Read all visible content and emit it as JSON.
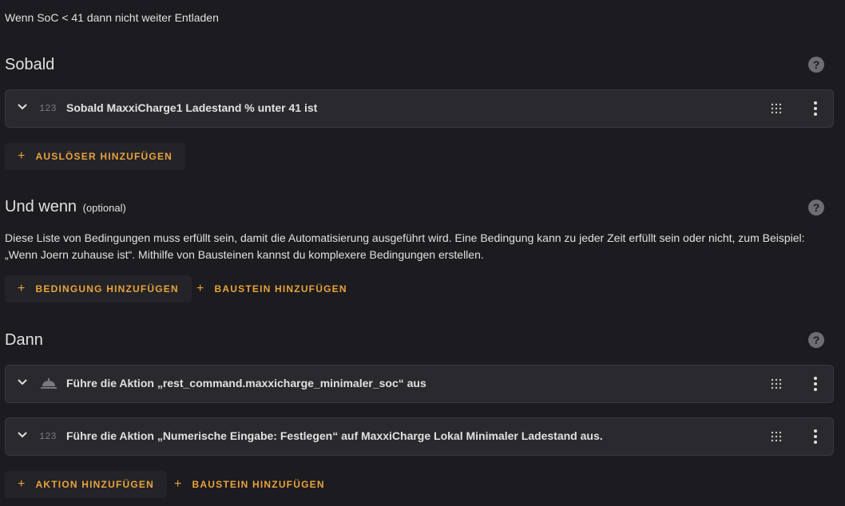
{
  "automation": {
    "description": "Wenn SoC < 41 dann nicht weiter Entladen"
  },
  "triggers": {
    "title": "Sobald",
    "help_icon": "help-circle-icon",
    "items": [
      {
        "label": "Sobald MaxxiCharge1 Ladestand % unter 41 ist",
        "type_icon_text": "123",
        "type_icon": "numeric-icon"
      }
    ],
    "add_label": "AUSLÖSER HINZUFÜGEN"
  },
  "conditions": {
    "title": "Und wenn",
    "optional_label": "(optional)",
    "help_icon": "help-circle-icon",
    "description": "Diese Liste von Bedingungen muss erfüllt sein, damit die Automatisierung ausgeführt wird. Eine Bedingung kann zu jeder Zeit erfüllt sein oder nicht, zum Beispiel: „Wenn Joern zuhause ist“. Mithilfe von Bausteinen kannst du komplexere Bedingungen erstellen.",
    "add_condition_label": "BEDINGUNG HINZUFÜGEN",
    "add_block_label": "BAUSTEIN HINZUFÜGEN"
  },
  "actions": {
    "title": "Dann",
    "help_icon": "help-circle-icon",
    "items": [
      {
        "label": "Führe die Aktion „rest_command.maxxicharge_minimaler_soc“ aus",
        "type_icon": "service-bell-icon"
      },
      {
        "label": "Führe die Aktion „Numerische Eingabe: Festlegen“ auf MaxxiCharge Lokal Minimaler Ladestand aus.",
        "type_icon_text": "123",
        "type_icon": "numeric-icon"
      }
    ],
    "add_action_label": "AKTION HINZUFÜGEN",
    "add_block_label": "BAUSTEIN HINZUFÜGEN"
  },
  "colors": {
    "background": "#1c1b1f",
    "card": "#2a292d",
    "accent": "#e8a33d",
    "text": "#e1e1e1",
    "icon_muted": "#7a797d"
  }
}
